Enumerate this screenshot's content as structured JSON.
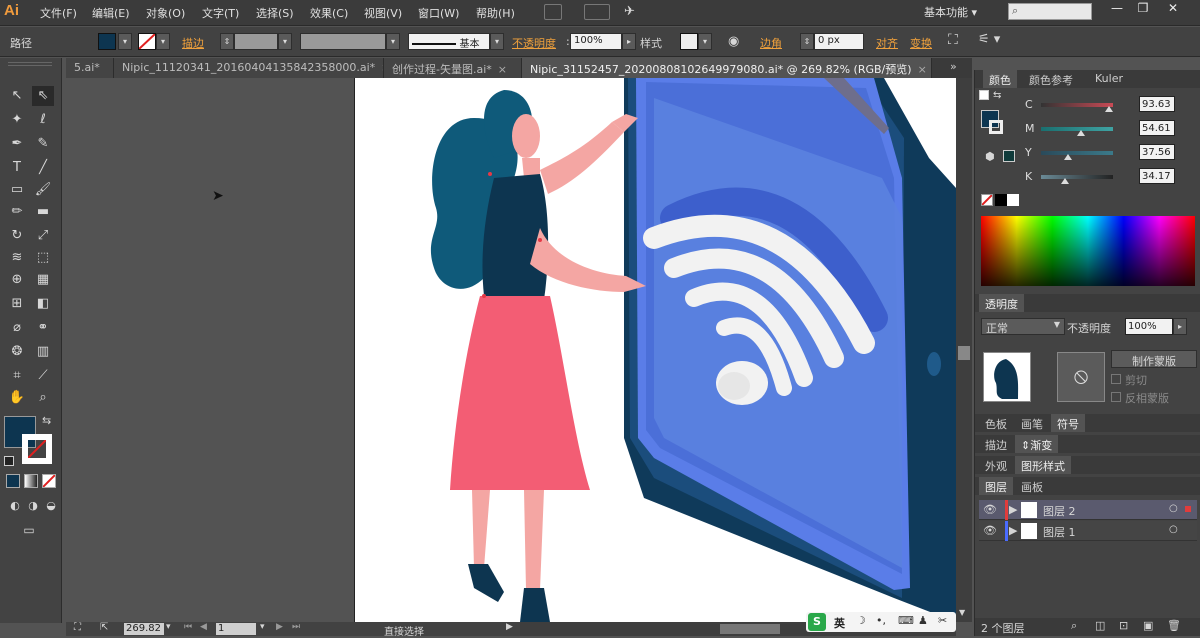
{
  "app": {
    "logo": "Ai"
  },
  "menu": [
    "文件(F)",
    "编辑(E)",
    "对象(O)",
    "文字(T)",
    "选择(S)",
    "效果(C)",
    "视图(V)",
    "窗口(W)",
    "帮助(H)"
  ],
  "workspace": "基本功能",
  "window_buttons": [
    "—",
    "❐",
    "✕"
  ],
  "control": {
    "object_type": "路径",
    "stroke_label": "描边",
    "stroke_style": "基本",
    "opacity_label": "不透明度",
    "opacity_value": "100%",
    "style_label": "样式",
    "corner_label": "边角",
    "corner_value": "0 px",
    "align_label": "对齐",
    "transform_label": "变换",
    "fill_color": "#0d3550"
  },
  "tabs": [
    {
      "label": "5.ai*",
      "active": false
    },
    {
      "label": "Nipic_11120341_20160404135842358000.ai*",
      "active": false
    },
    {
      "label": "创作过程-矢量图.ai*",
      "active": false
    },
    {
      "label": "Nipic_31152457_20200808102649979080.ai* @ 269.82% (RGB/预览)",
      "active": true
    }
  ],
  "status": {
    "zoom": "269.82",
    "page": "1",
    "tool_name": "直接选择"
  },
  "panels": {
    "color_tabs": [
      "颜色",
      "颜色参考",
      "Kuler"
    ],
    "cmyk": [
      {
        "label": "C",
        "value": "93.63",
        "pct": 0.94,
        "color": "#c94a55"
      },
      {
        "label": "M",
        "value": "54.61",
        "pct": 0.55,
        "color": "#3fa3a3"
      },
      {
        "label": "Y",
        "value": "37.56",
        "pct": 0.38,
        "color": "#3b7a8a"
      },
      {
        "label": "K",
        "value": "34.17",
        "pct": 0.34,
        "color": "#4a5a62"
      }
    ],
    "transparency_title": "透明度",
    "blend_mode": "正常",
    "opacity_label": "不透明度",
    "opacity_value": "100%",
    "make_mask": "制作蒙版",
    "clip": "剪切",
    "invert_mask": "反相蒙版",
    "row_tabs_1": [
      "色板",
      "画笔",
      "符号"
    ],
    "row_tabs_2": [
      "描边",
      "渐变"
    ],
    "row_tabs_3": [
      "外观",
      "图形样式"
    ],
    "layers_tabs": [
      "图层",
      "画板"
    ],
    "layers": [
      {
        "name": "图层 2",
        "selected": true,
        "color": "#e03c3c"
      },
      {
        "name": "图层 1",
        "selected": false,
        "color": "#4a6cff"
      }
    ],
    "layer_count": "2 个图层"
  },
  "ime": {
    "label": "英"
  }
}
